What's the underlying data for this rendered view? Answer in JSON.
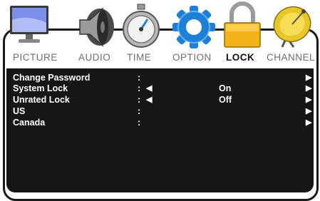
{
  "tabs": [
    {
      "label": "PICTURE",
      "icon": "monitor-icon",
      "active": false
    },
    {
      "label": "AUDIO",
      "icon": "speaker-icon",
      "active": false
    },
    {
      "label": "TIME",
      "icon": "stopwatch-icon",
      "active": false
    },
    {
      "label": "OPTION",
      "icon": "gear-icon",
      "active": false
    },
    {
      "label": "LOCK",
      "icon": "padlock-icon",
      "active": true
    },
    {
      "label": "CHANNEL",
      "icon": "satellite-dish-icon",
      "active": false
    }
  ],
  "settings": [
    {
      "label": "Change Password",
      "colon": ":",
      "left_arrow": "",
      "value": "",
      "right_arrow": "▶"
    },
    {
      "label": "System Lock",
      "colon": ":",
      "left_arrow": "◀",
      "value": "On",
      "right_arrow": "▶"
    },
    {
      "label": "Unrated Lock",
      "colon": ":",
      "left_arrow": "◀",
      "value": "Off",
      "right_arrow": "▶"
    },
    {
      "label": "US",
      "colon": ":",
      "left_arrow": "",
      "value": "",
      "right_arrow": "▶"
    },
    {
      "label": "Canada",
      "colon": ":",
      "left_arrow": "",
      "value": "",
      "right_arrow": "▶"
    }
  ],
  "colors": {
    "panel_bg": "#161616",
    "active_tab": "#111111",
    "inactive_tab": "#6f6f6f",
    "lock_gold": "#f2b21a",
    "option_blue": "#1d7fd6"
  }
}
